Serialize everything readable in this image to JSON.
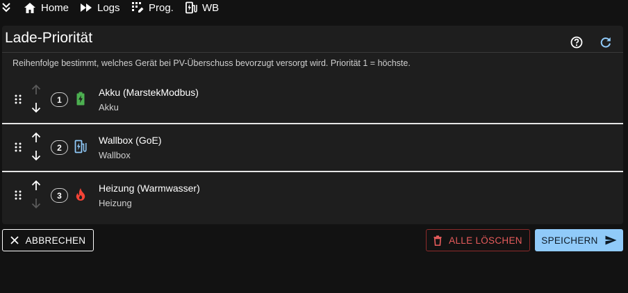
{
  "nav": {
    "items": [
      {
        "label": "Home",
        "icon": "home-icon"
      },
      {
        "label": "Logs",
        "icon": "fast-forward-icon"
      },
      {
        "label": "Prog.",
        "icon": "program-icon"
      },
      {
        "label": "WB",
        "icon": "ev-station-icon"
      }
    ]
  },
  "card": {
    "title": "Lade-Priorität",
    "description": "Reihenfolge bestimmt, welches Gerät bei PV-Überschuss bevorzugt versorgt wird. Priorität 1 = höchste.",
    "help_icon": "help-circle-icon",
    "refresh_icon": "refresh-icon"
  },
  "devices": [
    {
      "priority": "1",
      "name": "Akku (MarstekModbus)",
      "type": "Akku",
      "icon": "battery-charging-icon",
      "icon_color": "#4caf50",
      "up_enabled": false,
      "down_enabled": true
    },
    {
      "priority": "2",
      "name": "Wallbox (GoE)",
      "type": "Wallbox",
      "icon": "ev-station-icon",
      "icon_color": "#90caf9",
      "up_enabled": true,
      "down_enabled": true
    },
    {
      "priority": "3",
      "name": "Heizung (Warmwasser)",
      "type": "Heizung",
      "icon": "fire-icon",
      "icon_color": "#f44336",
      "up_enabled": true,
      "down_enabled": false
    }
  ],
  "actions": {
    "cancel_label": "ABBRECHEN",
    "delete_all_label": "ALLE LÖSCHEN",
    "save_label": "SPEICHERN"
  },
  "colors": {
    "background": "#121212",
    "card": "#1e1e1e",
    "accent": "#90caf9",
    "danger": "#e85c5c"
  }
}
